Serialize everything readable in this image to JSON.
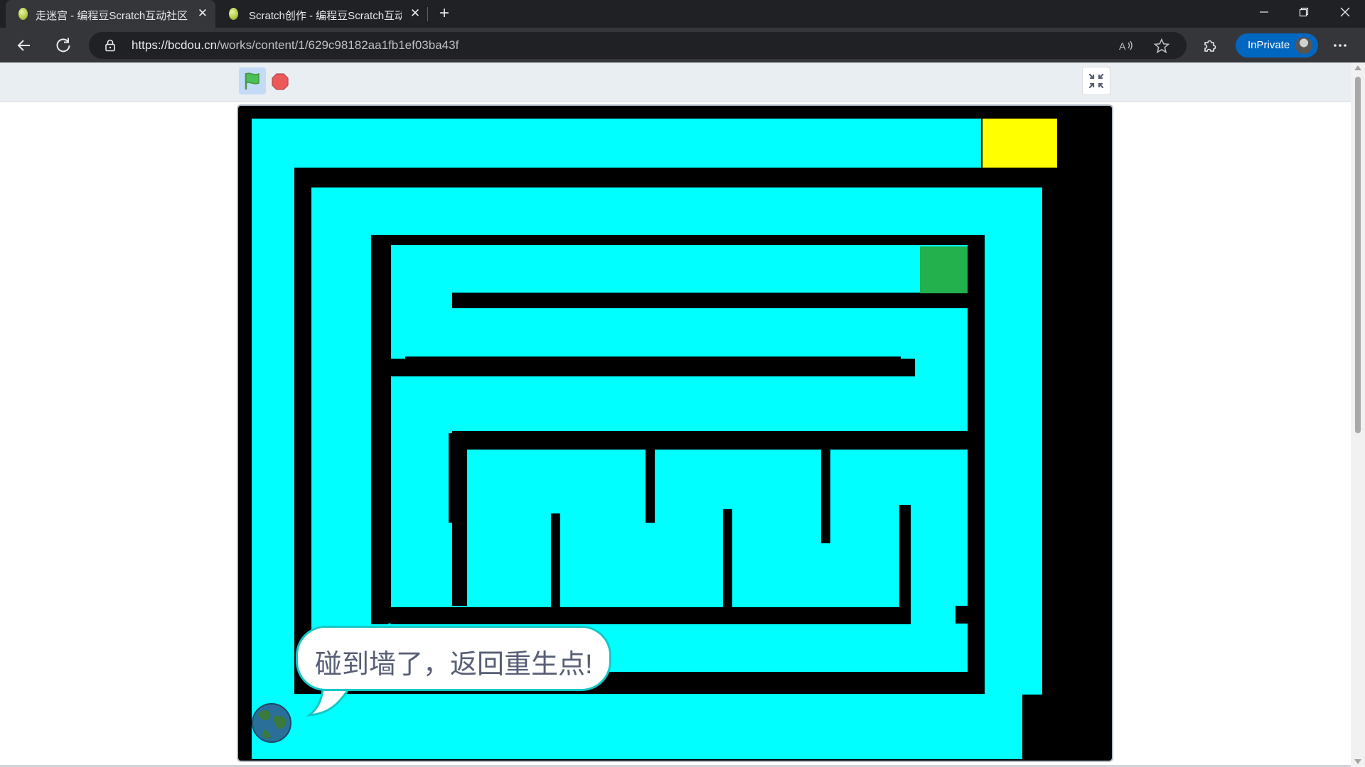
{
  "browser": {
    "tabs": [
      {
        "title": "走迷宫 - 编程豆Scratch互动社区",
        "active": true
      },
      {
        "title": "Scratch创作 - 编程豆Scratch互动",
        "active": false
      }
    ],
    "new_tab_symbol": "+",
    "url_host": "https://bcdou.cn",
    "url_path": "/works/content/1/629c98182aa1fb1ef03ba43f",
    "inprivate_label": "InPrivate",
    "window_controls": {
      "minimize": "—",
      "restore": "❐",
      "close": "✕"
    },
    "icons": [
      "back-arrow-icon",
      "refresh-icon",
      "lock-icon",
      "read-aloud-icon",
      "favorite-star-icon",
      "extensions-icon",
      "more-icon"
    ]
  },
  "player": {
    "green_flag_color": "#4cbf56",
    "stop_color": "#ec5959",
    "icons": [
      "green-flag-icon",
      "stop-icon",
      "exit-fullscreen-icon"
    ]
  },
  "stage": {
    "colors": {
      "path": "#00ffff",
      "wall": "#000000",
      "goal": "#ffff00",
      "checkpoint": "#22b14c"
    },
    "speech_bubble": "碰到墙了，返回重生点!",
    "sprite": "earth-ball"
  }
}
